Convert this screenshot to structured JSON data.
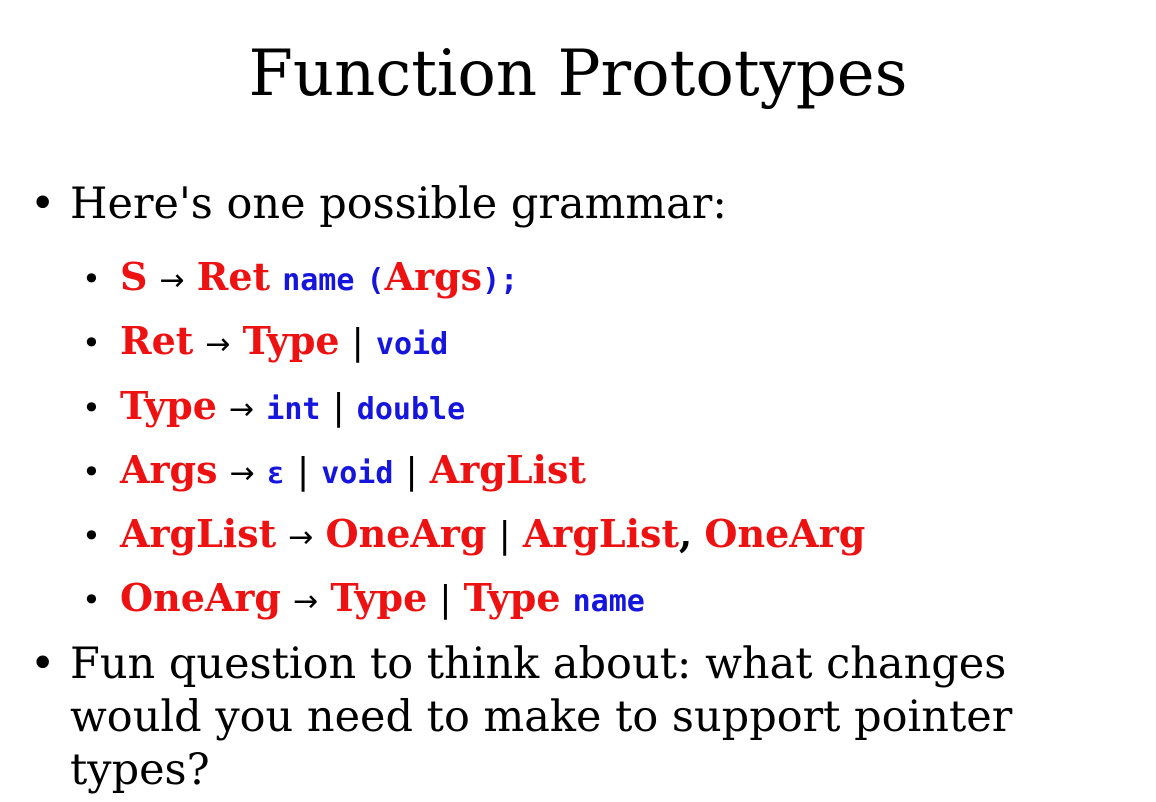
{
  "slide": {
    "title": "Function Prototypes",
    "bullets": [
      {
        "text": "Here's one possible grammar:"
      },
      {
        "text": "Fun question to think about: what changes would you need to make to support pointer types?"
      }
    ],
    "rules": [
      {
        "lhs": "S",
        "arrow": "→",
        "rhs": [
          {
            "kind": "nt",
            "text": "Ret"
          },
          {
            "kind": "tm",
            "text": "name"
          },
          {
            "kind": "tm",
            "text": "("
          },
          {
            "kind": "nt",
            "text": "Args"
          },
          {
            "kind": "tm",
            "text": ");"
          }
        ]
      },
      {
        "lhs": "Ret",
        "arrow": "→",
        "rhs": [
          {
            "kind": "nt",
            "text": "Type"
          },
          {
            "kind": "bar",
            "text": "|"
          },
          {
            "kind": "tm",
            "text": "void"
          }
        ]
      },
      {
        "lhs": "Type",
        "arrow": "→",
        "rhs": [
          {
            "kind": "tm",
            "text": "int"
          },
          {
            "kind": "bar",
            "text": "|"
          },
          {
            "kind": "tm",
            "text": "double"
          }
        ]
      },
      {
        "lhs": "Args",
        "arrow": "→",
        "rhs": [
          {
            "kind": "tm",
            "text": "ε"
          },
          {
            "kind": "bar",
            "text": "|"
          },
          {
            "kind": "tm",
            "text": "void"
          },
          {
            "kind": "bar",
            "text": "|"
          },
          {
            "kind": "nt",
            "text": "ArgList"
          }
        ]
      },
      {
        "lhs": "ArgList",
        "arrow": "→",
        "rhs": [
          {
            "kind": "nt",
            "text": "OneArg"
          },
          {
            "kind": "bar",
            "text": "|"
          },
          {
            "kind": "nt",
            "text": "ArgList"
          },
          {
            "kind": "punct",
            "text": ","
          },
          {
            "kind": "nt",
            "text": "OneArg"
          }
        ]
      },
      {
        "lhs": "OneArg",
        "arrow": "→",
        "rhs": [
          {
            "kind": "nt",
            "text": "Type"
          },
          {
            "kind": "bar",
            "text": "|"
          },
          {
            "kind": "nt",
            "text": "Type"
          },
          {
            "kind": "tm",
            "text": "name"
          }
        ]
      }
    ],
    "colors": {
      "nonterminal": "#ee1111",
      "terminal": "#1515dd",
      "text": "#000000",
      "background": "#ffffff"
    }
  }
}
